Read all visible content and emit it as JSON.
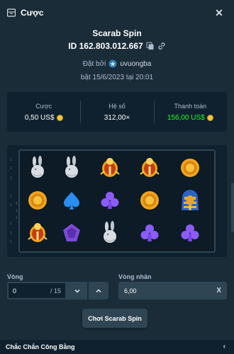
{
  "header": {
    "title": "Cược",
    "ticket_icon": "ticket-icon",
    "close_icon": "close-icon"
  },
  "bet": {
    "game": "Scarab Spin",
    "id": "ID 162.803.012.667",
    "placed_by_label": "Đặt bởi",
    "user": "uvuongba",
    "date": "bật 15/6/2023 tại 20:01"
  },
  "stats": {
    "bet_label": "Cược",
    "bet_value": "0,50 US$",
    "multiplier_label": "Hệ số",
    "multiplier_value": "312,00×",
    "payout_label": "Thanh toán",
    "payout_value": "156,00 US$",
    "payout_color": "#1fff20"
  },
  "reel_numbers": {
    "col0": [
      "1",
      "1",
      "1",
      "1",
      "1"
    ],
    "col1": [
      "1",
      "1",
      "1"
    ],
    "col2": [
      "1",
      "1",
      "1"
    ]
  },
  "board": {
    "rows": [
      [
        "rabbit",
        "rabbit",
        "scarab",
        "scarab",
        "coin"
      ],
      [
        "coin",
        "spade",
        "club",
        "coin",
        "pharaoh"
      ],
      [
        "scarab",
        "gem",
        "rabbit",
        "club",
        "club"
      ]
    ]
  },
  "controls": {
    "spins_label": "Vòng",
    "spins_value": "0",
    "spins_max": "/ 15",
    "multiplier_label": "Vòng nhân",
    "multiplier_value": "6,00",
    "clear_label": "X",
    "down_icon": "chevron-down-icon",
    "up_icon": "chevron-up-icon",
    "play_label": "Chơi Scarab Spin"
  },
  "footer": {
    "fairness_label": "Chắc Chắn Công Bằng",
    "chevron_icon": "chevron-left-icon"
  }
}
